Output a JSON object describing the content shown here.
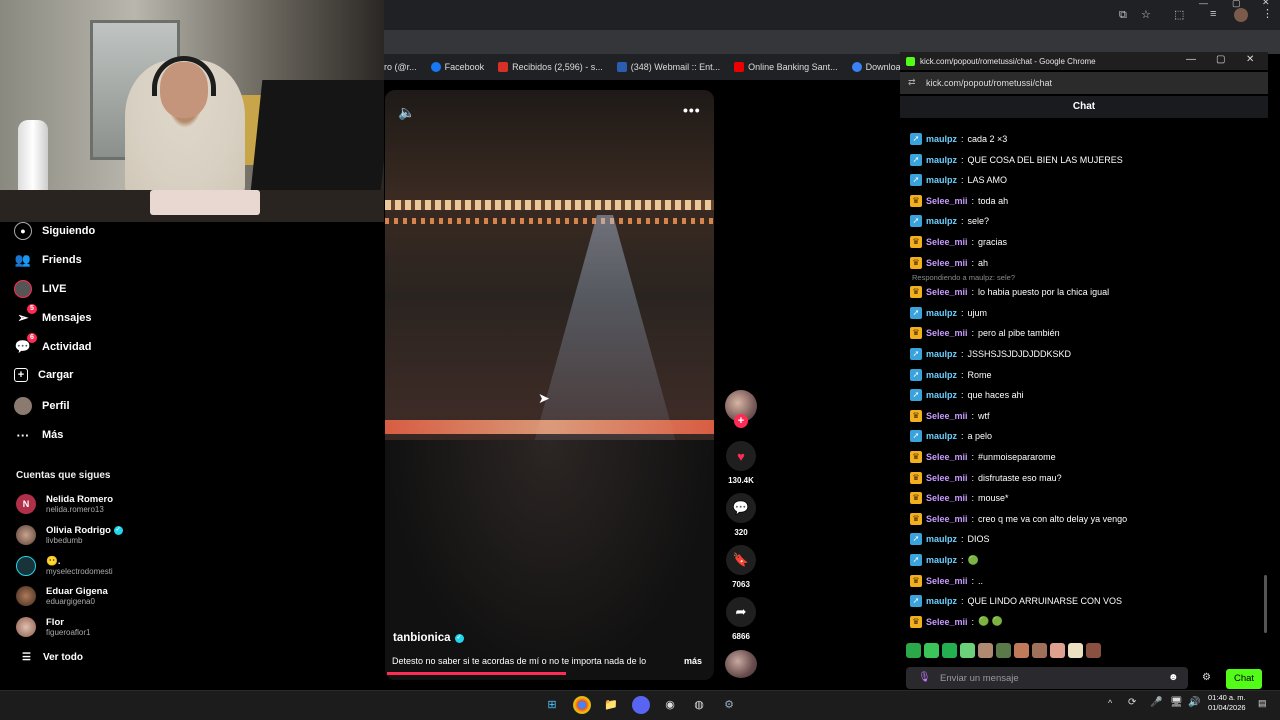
{
  "browser_main": {
    "bookmarks": [
      {
        "label": "ro (@r...",
        "color": "#666"
      },
      {
        "label": "Facebook",
        "color": "#1877f2"
      },
      {
        "label": "Recibidos (2,596) - s...",
        "color": "#d93025"
      },
      {
        "label": "(348) Webmail :: Ent...",
        "color": "#2a5db0"
      },
      {
        "label": "Online Banking Sant...",
        "color": "#e00"
      },
      {
        "label": "Download Twitter Vi...",
        "color": "#3b82f6"
      }
    ]
  },
  "sidebar": {
    "nav": [
      {
        "label": "Siguiendo",
        "icon": "following-icon",
        "badge": ""
      },
      {
        "label": "Friends",
        "icon": "friends-icon",
        "badge": ""
      },
      {
        "label": "LIVE",
        "icon": "live-icon",
        "badge": ""
      },
      {
        "label": "Mensajes",
        "icon": "messages-icon",
        "badge": "5"
      },
      {
        "label": "Actividad",
        "icon": "activity-icon",
        "badge": "6"
      },
      {
        "label": "Cargar",
        "icon": "upload-icon",
        "badge": ""
      },
      {
        "label": "Perfil",
        "icon": "profile-icon",
        "badge": ""
      },
      {
        "label": "Más",
        "icon": "more-icon",
        "badge": ""
      }
    ],
    "following_title": "Cuentas que sigues",
    "accounts": [
      {
        "name": "Nelida Romero",
        "username": "nelida.romero13",
        "verified": false,
        "avatar_letter": "N"
      },
      {
        "name": "Olivia Rodrigo",
        "username": "livbedumb",
        "verified": true,
        "avatar_letter": ""
      },
      {
        "name": "😶.",
        "username": "myselectrodomesti",
        "verified": false,
        "avatar_letter": ""
      },
      {
        "name": "Eduar Gigena",
        "username": "eduargigena0",
        "verified": false,
        "avatar_letter": ""
      },
      {
        "name": "Flor",
        "username": "figueroaflor1",
        "verified": false,
        "avatar_letter": ""
      }
    ],
    "see_all": "Ver todo"
  },
  "video": {
    "username": "tanbionica",
    "caption": "Detesto no saber si te acordas de mí o no te importa nada de lo",
    "more": "más",
    "likes": "130.4K",
    "comments": "320",
    "saves": "7063",
    "shares": "6866",
    "progress_fraction": 0.55
  },
  "chat_window": {
    "title": "kick.com/popout/rometussi/chat - Google Chrome",
    "url": "kick.com/popout/rometussi/chat",
    "header": "Chat",
    "messages": [
      {
        "user": "maulpz",
        "badge": "blue",
        "text": "cada 2 ×3"
      },
      {
        "user": "maulpz",
        "badge": "blue",
        "text": "QUE COSA DEL BIEN LAS MUJERES"
      },
      {
        "user": "maulpz",
        "badge": "blue",
        "text": "LAS AMO"
      },
      {
        "user": "Selee_mii",
        "badge": "gold",
        "text": "toda ah"
      },
      {
        "user": "maulpz",
        "badge": "blue",
        "text": "sele?"
      },
      {
        "user": "Selee_mii",
        "badge": "gold",
        "text": "gracias"
      },
      {
        "user": "Selee_mii",
        "badge": "gold",
        "text": "ah"
      },
      {
        "user": "Selee_mii",
        "badge": "gold",
        "text": "lo habia puesto por la chica igual",
        "reply": "Respondiendo a maulpz: sele?"
      },
      {
        "user": "maulpz",
        "badge": "blue",
        "text": "ujum"
      },
      {
        "user": "Selee_mii",
        "badge": "gold",
        "text": "pero al pibe también"
      },
      {
        "user": "maulpz",
        "badge": "blue",
        "text": "JSSHSJSJDJDJDDKSKD"
      },
      {
        "user": "maulpz",
        "badge": "blue",
        "text": "Rome"
      },
      {
        "user": "maulpz",
        "badge": "blue",
        "text": "que haces ahi"
      },
      {
        "user": "Selee_mii",
        "badge": "gold",
        "text": "wtf"
      },
      {
        "user": "maulpz",
        "badge": "blue",
        "text": "a pelo"
      },
      {
        "user": "Selee_mii",
        "badge": "gold",
        "text": "#unmoisepararome"
      },
      {
        "user": "Selee_mii",
        "badge": "gold",
        "text": "disfrutaste eso mau?"
      },
      {
        "user": "Selee_mii",
        "badge": "gold",
        "text": "mouse*"
      },
      {
        "user": "Selee_mii",
        "badge": "gold",
        "text": "creo q me va con alto delay ya vengo"
      },
      {
        "user": "maulpz",
        "badge": "blue",
        "text": "DIOS"
      },
      {
        "user": "maulpz",
        "badge": "blue",
        "text": "🟢"
      },
      {
        "user": "Selee_mii",
        "badge": "gold",
        "text": ".."
      },
      {
        "user": "maulpz",
        "badge": "blue",
        "text": "QUE LINDO ARRUINARSE CON VOS"
      },
      {
        "user": "Selee_mii",
        "badge": "gold",
        "text": "🟢 🟢"
      }
    ],
    "input_placeholder": "Enviar un mensaje",
    "send_label": "Chat"
  },
  "taskbar": {
    "time": "01:40 a. m.",
    "date": "01/04/2026"
  }
}
